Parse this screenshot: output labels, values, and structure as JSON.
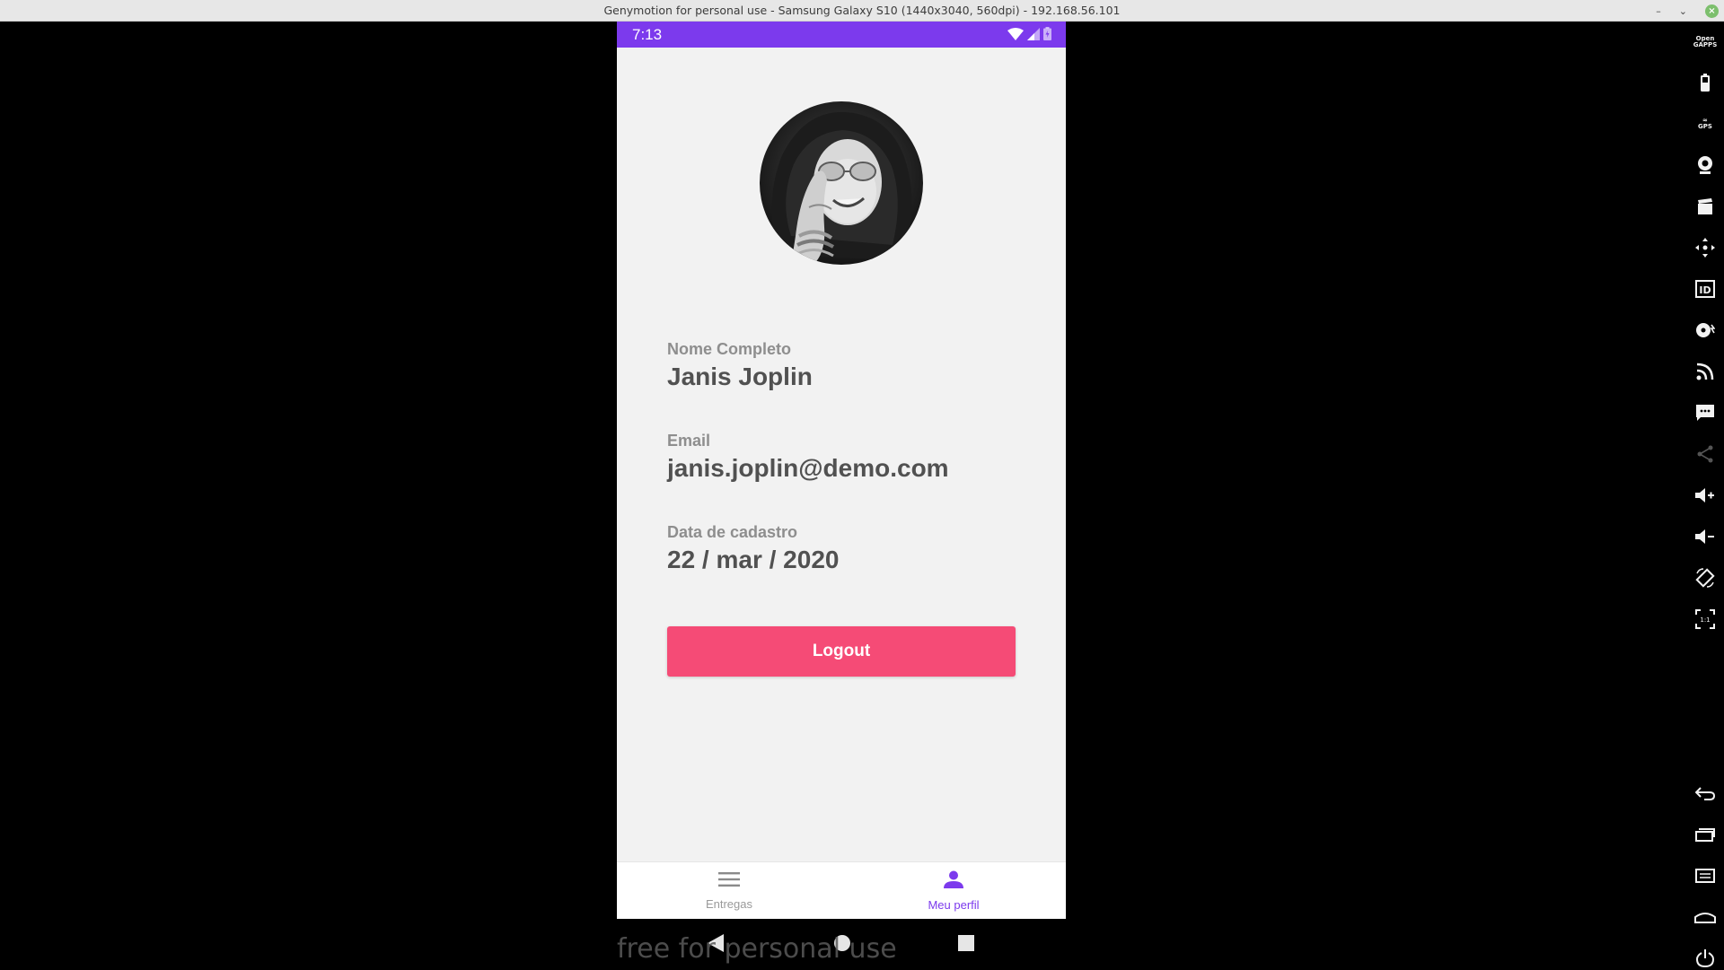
{
  "window": {
    "title": "Genymotion for personal use - Samsung Galaxy S10 (1440x3040, 560dpi) - 192.168.56.101",
    "controls": [
      "minimize",
      "maximize",
      "close"
    ]
  },
  "toolbar": {
    "items": [
      {
        "name": "open-gapps",
        "text": "Open GAPPS"
      },
      {
        "name": "battery"
      },
      {
        "name": "gps",
        "text": "GPS"
      },
      {
        "name": "webcam"
      },
      {
        "name": "screen-capture"
      },
      {
        "name": "remote-control"
      },
      {
        "name": "identifiers",
        "text": "ID"
      },
      {
        "name": "disk-io"
      },
      {
        "name": "network"
      },
      {
        "name": "sms"
      },
      {
        "name": "share"
      },
      {
        "name": "volume-up"
      },
      {
        "name": "volume-down"
      },
      {
        "name": "rotate"
      },
      {
        "name": "pixel-perfect",
        "text": "1:1"
      },
      {
        "name": "back"
      },
      {
        "name": "recent-apps"
      },
      {
        "name": "menu"
      },
      {
        "name": "home"
      },
      {
        "name": "power"
      }
    ]
  },
  "status_bar": {
    "time": "7:13",
    "color": "#7c3aed"
  },
  "profile": {
    "avatar_alt": "profile photo",
    "fields": [
      {
        "label": "Nome Completo",
        "value": "Janis Joplin"
      },
      {
        "label": "Email",
        "value": "janis.joplin@demo.com"
      },
      {
        "label": "Data de cadastro",
        "value": "22 / mar / 2020"
      }
    ],
    "logout_label": "Logout",
    "logout_color": "#f54b76"
  },
  "bottom_nav": {
    "items": [
      {
        "label": "Entregas",
        "icon": "menu-icon",
        "active": false
      },
      {
        "label": "Meu perfil",
        "icon": "person-icon",
        "active": true
      }
    ],
    "active_color": "#7c3aed"
  },
  "watermark": "free for personal use"
}
